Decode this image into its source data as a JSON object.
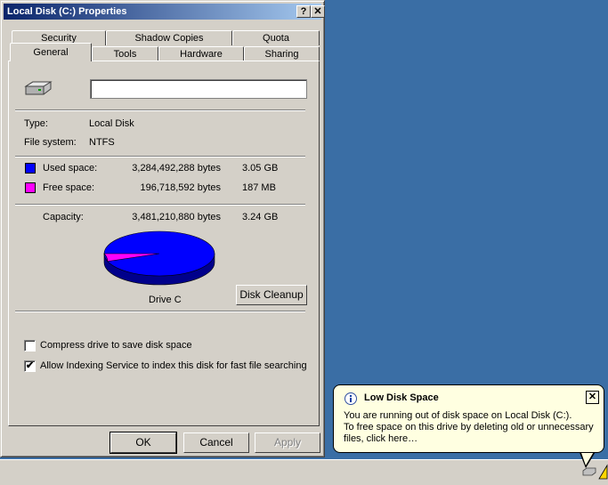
{
  "dialog": {
    "title": "Local Disk (C:) Properties",
    "help_label": "?",
    "close_label": "✕",
    "tabs_row1": [
      "Security",
      "Shadow Copies",
      "Quota"
    ],
    "tabs_row2": [
      "General",
      "Tools",
      "Hardware",
      "Sharing"
    ],
    "selected_tab": "General",
    "general": {
      "label_value": "",
      "type_label": "Type:",
      "type_value": "Local Disk",
      "fs_label": "File system:",
      "fs_value": "NTFS",
      "used_label": "Used space:",
      "used_bytes": "3,284,492,288 bytes",
      "used_size": "3.05 GB",
      "free_label": "Free space:",
      "free_bytes": "196,718,592 bytes",
      "free_size": "187 MB",
      "capacity_label": "Capacity:",
      "capacity_bytes": "3,481,210,880 bytes",
      "capacity_size": "3.24 GB",
      "drive_label": "Drive C",
      "cleanup_label": "Disk Cleanup",
      "compress_label": "Compress drive to save disk space",
      "compress_checked": false,
      "index_label": "Allow Indexing Service to index this disk for fast file searching",
      "index_checked": true
    },
    "buttons": {
      "ok": "OK",
      "cancel": "Cancel",
      "apply": "Apply"
    }
  },
  "colors": {
    "used": "#0000ff",
    "free": "#ff00ff",
    "desktop": "#3a6ea5",
    "titlebar": "#0a246a"
  },
  "chart_data": {
    "type": "pie",
    "categories": [
      "Used space",
      "Free space"
    ],
    "values": [
      3284492288,
      196718592
    ],
    "colors": [
      "#0000ff",
      "#ff00ff"
    ],
    "title": "Drive C"
  },
  "balloon": {
    "info_icon": "info-icon",
    "title": "Low Disk Space",
    "close_label": "✕",
    "line1": "You are running out of disk space on Local Disk (C:).",
    "line2": "To free space on this drive by deleting old or unnecessary",
    "line3": "files, click here…"
  }
}
